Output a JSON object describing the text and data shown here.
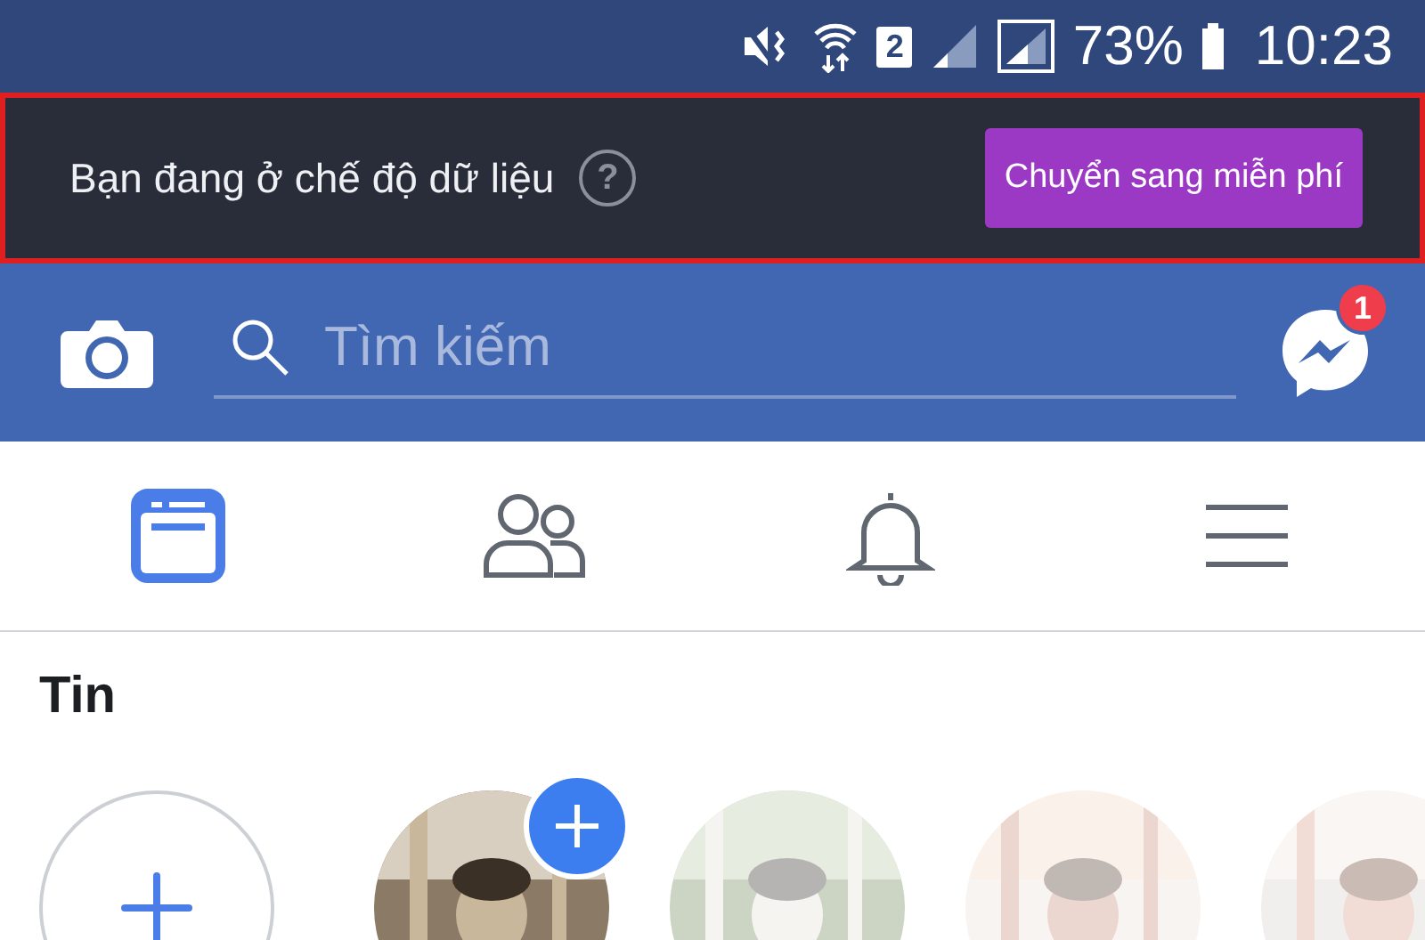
{
  "status_bar": {
    "battery": "73%",
    "time": "10:23",
    "sim": "2"
  },
  "data_banner": {
    "message": "Bạn đang ở chế độ dữ liệu",
    "help": "?",
    "button": "Chuyển sang miễn phí",
    "highlighted": true
  },
  "header": {
    "search": {
      "placeholder": "Tìm kiếm"
    },
    "messenger_badge": "1"
  },
  "nav_tabs": [
    {
      "kind": "feed",
      "selected": true
    },
    {
      "kind": "friends",
      "selected": false
    },
    {
      "kind": "notifications",
      "selected": false
    },
    {
      "kind": "menu",
      "selected": false
    }
  ],
  "stories": {
    "title": "Tin",
    "items": [
      {
        "kind": "add"
      },
      {
        "kind": "picture",
        "add_badge": true,
        "faded": false
      },
      {
        "kind": "picture",
        "add_badge": false,
        "faded": true
      },
      {
        "kind": "picture",
        "add_badge": false,
        "faded": true
      },
      {
        "kind": "picture",
        "add_badge": false,
        "faded": true
      }
    ]
  }
}
